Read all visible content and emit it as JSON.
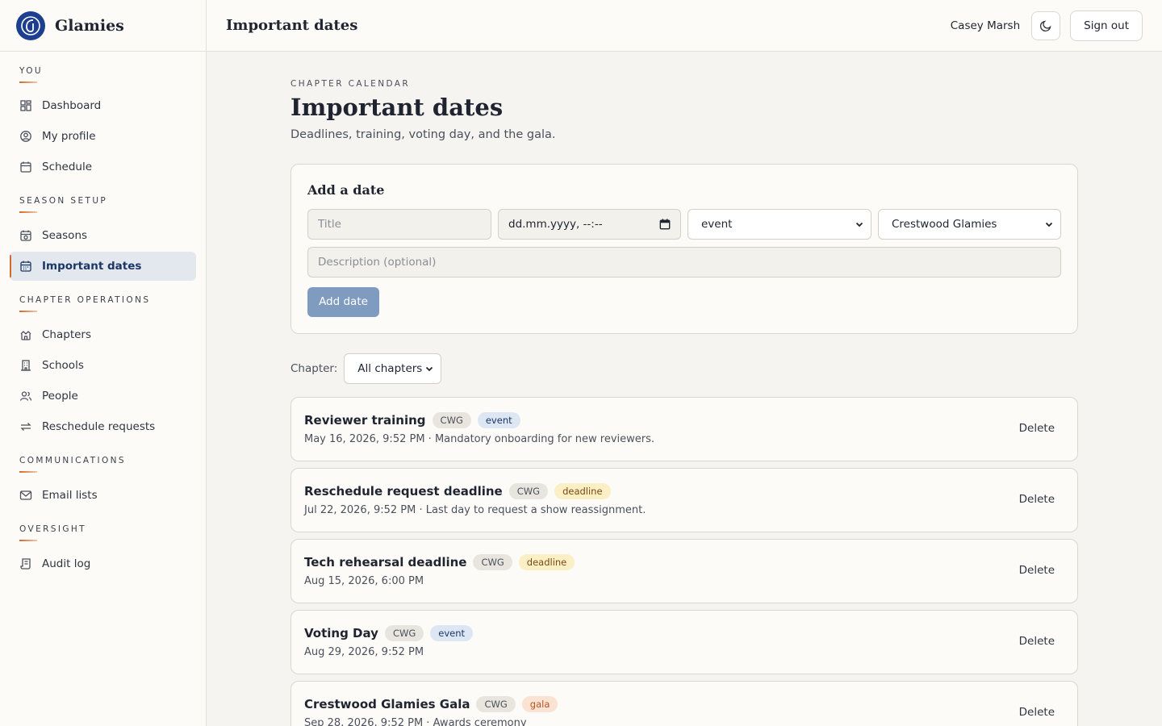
{
  "brand": {
    "name": "Glamies"
  },
  "header": {
    "title": "Important dates",
    "user_name": "Casey Marsh",
    "sign_out_label": "Sign out"
  },
  "sidebar": {
    "sections": [
      {
        "label": "YOU",
        "items": [
          {
            "label": "Dashboard",
            "icon": "dashboard-icon"
          },
          {
            "label": "My profile",
            "icon": "profile-icon"
          },
          {
            "label": "Schedule",
            "icon": "calendar-icon"
          }
        ]
      },
      {
        "label": "SEASON SETUP",
        "items": [
          {
            "label": "Seasons",
            "icon": "calendar-clock-icon"
          },
          {
            "label": "Important dates",
            "icon": "calendar-icon",
            "active": true
          }
        ]
      },
      {
        "label": "CHAPTER OPERATIONS",
        "items": [
          {
            "label": "Chapters",
            "icon": "chapters-icon"
          },
          {
            "label": "Schools",
            "icon": "school-icon"
          },
          {
            "label": "People",
            "icon": "people-icon"
          },
          {
            "label": "Reschedule requests",
            "icon": "swap-icon"
          }
        ]
      },
      {
        "label": "COMMUNICATIONS",
        "items": [
          {
            "label": "Email lists",
            "icon": "mail-icon"
          }
        ]
      },
      {
        "label": "OVERSIGHT",
        "items": [
          {
            "label": "Audit log",
            "icon": "scroll-icon"
          }
        ]
      }
    ]
  },
  "page": {
    "eyebrow": "CHAPTER CALENDAR",
    "title": "Important dates",
    "subtitle": "Deadlines, training, voting day, and the gala."
  },
  "form": {
    "title": "Add a date",
    "title_placeholder": "Title",
    "date_placeholder": "dd.mm.yyyy, --:--",
    "type_value": "event",
    "chapter_value": "Crestwood Glamies",
    "description_placeholder": "Description (optional)",
    "submit_label": "Add date"
  },
  "filter": {
    "label": "Chapter:",
    "value": "All chapters"
  },
  "dates": [
    {
      "title": "Reviewer training",
      "code": "CWG",
      "type": "event",
      "subtitle": "May 16, 2026, 9:52 PM · Mandatory onboarding for new reviewers."
    },
    {
      "title": "Reschedule request deadline",
      "code": "CWG",
      "type": "deadline",
      "subtitle": "Jul 22, 2026, 9:52 PM · Last day to request a show reassignment."
    },
    {
      "title": "Tech rehearsal deadline",
      "code": "CWG",
      "type": "deadline",
      "subtitle": "Aug 15, 2026, 6:00 PM"
    },
    {
      "title": "Voting Day",
      "code": "CWG",
      "type": "event",
      "subtitle": "Aug 29, 2026, 9:52 PM"
    },
    {
      "title": "Crestwood Glamies Gala",
      "code": "CWG",
      "type": "gala",
      "subtitle": "Sep 28, 2026, 9:52 PM · Awards ceremony"
    }
  ],
  "delete_label": "Delete"
}
